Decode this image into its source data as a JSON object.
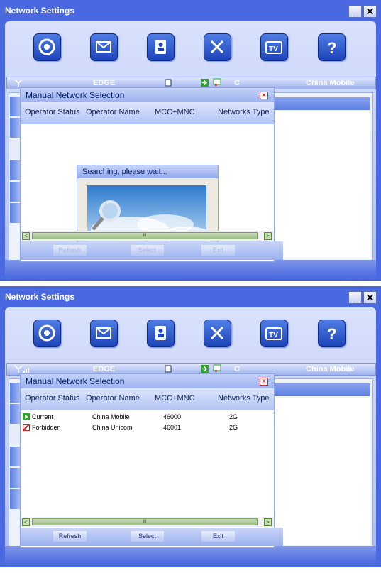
{
  "windows": [
    {
      "title": "Network Settings",
      "controls": {
        "minimize": "_",
        "close": "✕"
      },
      "toolbar": [
        "internet-icon",
        "messages-icon",
        "contacts-icon",
        "tools-icon",
        "tv-icon",
        "help-icon"
      ],
      "status": {
        "network_type": "EDGE",
        "c_label": "C",
        "operator": "China Mobile"
      },
      "dialog": {
        "title": "Manual Network Selection",
        "columns": [
          "Operator Status",
          "Operator Name",
          "MCC+MNC",
          "Networks Type"
        ],
        "searching_title": "Searching, please wait...",
        "rows": [],
        "scrollbar": {
          "left": "<",
          "thumb": "III",
          "right": ">"
        },
        "buttons": {
          "refresh": "Refresh",
          "select": "Select",
          "exit": "Exit"
        },
        "buttons_enabled": false
      }
    },
    {
      "title": "Network Settings",
      "controls": {
        "minimize": "_",
        "close": "✕"
      },
      "toolbar": [
        "internet-icon",
        "messages-icon",
        "contacts-icon",
        "tools-icon",
        "tv-icon",
        "help-icon"
      ],
      "status": {
        "network_type": "EDGE",
        "c_label": "C",
        "operator": "China Mobile"
      },
      "dialog": {
        "title": "Manual Network Selection",
        "columns": [
          "Operator Status",
          "Operator Name",
          "MCC+MNC",
          "Networks Type"
        ],
        "rows": [
          {
            "status": "Current",
            "status_icon": "current-play-icon",
            "name": "China Mobile",
            "mcc_mnc": "46000",
            "type": "2G"
          },
          {
            "status": "Forbidden",
            "status_icon": "forbidden-icon",
            "name": "China Unicom",
            "mcc_mnc": "46001",
            "type": "2G"
          }
        ],
        "scrollbar": {
          "left": "<",
          "thumb": "III",
          "right": ">"
        },
        "buttons": {
          "refresh": "Refresh",
          "select": "Select",
          "exit": "Exit"
        },
        "buttons_enabled": true
      }
    }
  ],
  "colors": {
    "window_blue": "#4a68e0",
    "button_blue": "#1e44b8",
    "status_current": "#2aa52a",
    "status_forbidden": "#d02020"
  }
}
